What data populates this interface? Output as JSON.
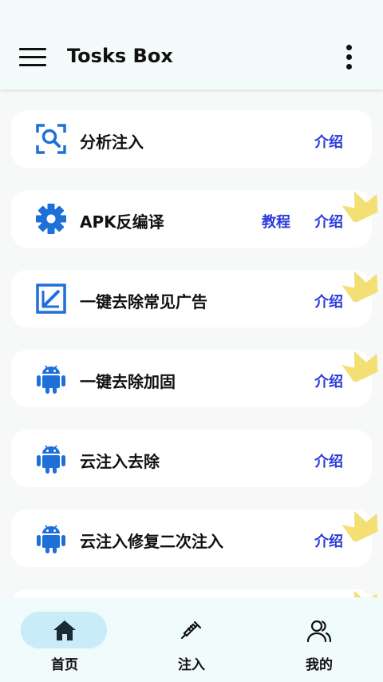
{
  "app": {
    "title": "Tosks Box"
  },
  "colors": {
    "accent": "#1f6fd8",
    "link": "#2a3bd8",
    "nav_active": "#c8ecf8",
    "crown": "#f4df74"
  },
  "items": [
    {
      "label": "分析注入",
      "icon": "scan-search-icon",
      "links": [
        "介绍"
      ],
      "crown": false
    },
    {
      "label": "APK反编译",
      "icon": "gear-icon",
      "links": [
        "教程",
        "介绍"
      ],
      "crown": true
    },
    {
      "label": "一键去除常见广告",
      "icon": "edit-square-icon",
      "links": [
        "介绍"
      ],
      "crown": true
    },
    {
      "label": "一键去除加固",
      "icon": "android-icon",
      "links": [
        "介绍"
      ],
      "crown": true
    },
    {
      "label": "云注入去除",
      "icon": "android-icon",
      "links": [
        "介绍"
      ],
      "crown": false
    },
    {
      "label": "云注入修复二次注入",
      "icon": "android-icon",
      "links": [
        "介绍"
      ],
      "crown": true
    }
  ],
  "nav": [
    {
      "label": "首页",
      "icon": "home-icon",
      "active": true
    },
    {
      "label": "注入",
      "icon": "syringe-icon",
      "active": false
    },
    {
      "label": "我的",
      "icon": "user-group-icon",
      "active": false
    }
  ]
}
